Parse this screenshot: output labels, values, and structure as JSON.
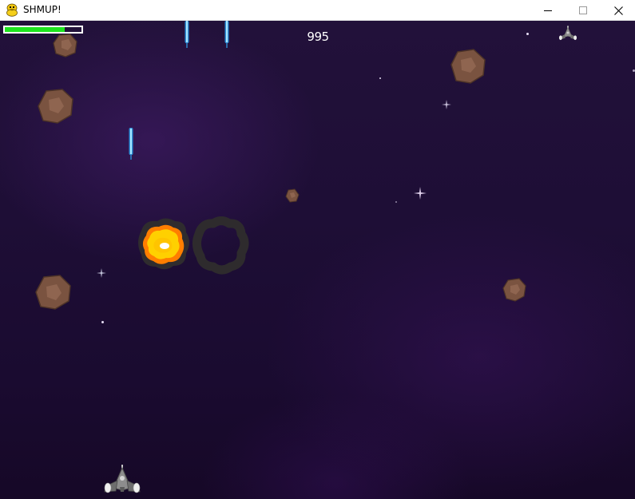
{
  "window": {
    "title": "SHMUP!",
    "app_icon": "python-snake-icon",
    "controls": {
      "minimize_icon": "minimize-icon",
      "maximize_icon": "maximize-icon",
      "close_icon": "close-icon"
    }
  },
  "hud": {
    "score": "995",
    "health_fraction": 0.78,
    "health_color": "#1ee41e",
    "health_border_color": "#ffffff",
    "lives": 1,
    "life_icon": "player-ship-icon"
  },
  "scene": {
    "background_color": "#1e0e36",
    "asteroid_color": "#7a5340",
    "laser_color": "#3aa9e6",
    "explosion_colors": [
      "#ffffff",
      "#ffd400",
      "#ff8a00",
      "#3a3a3a"
    ]
  }
}
